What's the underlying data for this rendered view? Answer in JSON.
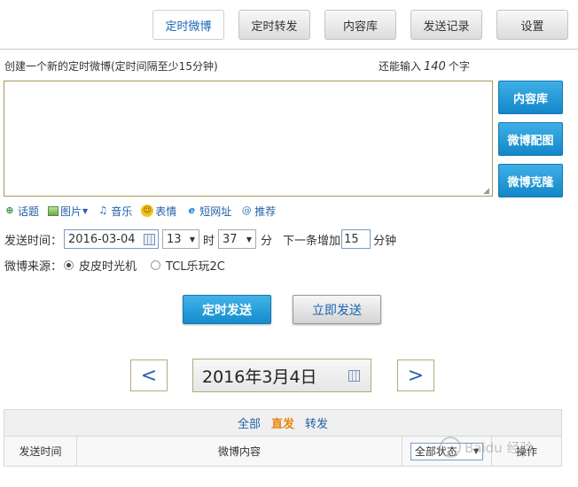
{
  "tabs": [
    {
      "label": "定时微博",
      "active": true
    },
    {
      "label": "定时转发",
      "active": false
    },
    {
      "label": "内容库",
      "active": false
    },
    {
      "label": "发送记录",
      "active": false
    },
    {
      "label": "设置",
      "active": false
    }
  ],
  "composer": {
    "hint": "创建一个新的定时微博(定时间隔至少15分钟)",
    "remaining_prefix": "还能输入",
    "remaining_count": "140",
    "remaining_suffix": "个字",
    "value": ""
  },
  "side_buttons": [
    "内容库",
    "微博配图",
    "微博克隆"
  ],
  "tools": [
    {
      "label": "话题",
      "icon": "topic-icon"
    },
    {
      "label": "图片",
      "icon": "image-icon",
      "dropdown": true
    },
    {
      "label": "音乐",
      "icon": "music-icon"
    },
    {
      "label": "表情",
      "icon": "emoji-icon"
    },
    {
      "label": "短网址",
      "icon": "short-url-icon"
    },
    {
      "label": "推荐",
      "icon": "at-icon"
    }
  ],
  "schedule": {
    "label": "发送时间：",
    "date": "2016-03-04",
    "hour": "13",
    "hour_unit": "时",
    "minute": "37",
    "minute_unit": "分",
    "next_label": "下一条增加",
    "increment": "15",
    "increment_unit": "分钟"
  },
  "source": {
    "label": "微博来源：",
    "options": [
      {
        "label": "皮皮时光机",
        "selected": true
      },
      {
        "label": "TCL乐玩2C",
        "selected": false
      }
    ]
  },
  "actions": {
    "scheduled_send": "定时发送",
    "send_now": "立即发送"
  },
  "date_nav": {
    "prev": "<",
    "next": ">",
    "current": "2016年3月4日"
  },
  "filters": [
    {
      "label": "全部",
      "active": false
    },
    {
      "label": "直发",
      "active": true
    },
    {
      "label": "转发",
      "active": false
    }
  ],
  "table": {
    "col_time": "发送时间",
    "col_content": "微博内容",
    "status_select": "全部状态",
    "col_action": "操作"
  },
  "watermark": "Baidu 经验"
}
